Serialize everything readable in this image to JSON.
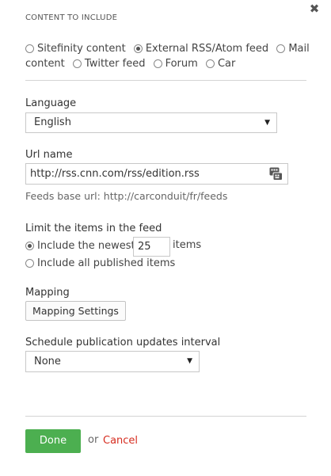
{
  "header": {
    "section_title": "CONTENT TO INCLUDE",
    "close_glyph": "✖",
    "close_icon": "close-icon"
  },
  "content_types": {
    "options": [
      {
        "label": "Sitefinity content",
        "checked": false
      },
      {
        "label": "External RSS/Atom feed",
        "checked": true
      },
      {
        "label": "Mail content",
        "checked": false
      },
      {
        "label": "Twitter feed",
        "checked": false
      },
      {
        "label": "Forum",
        "checked": false
      },
      {
        "label": "Car",
        "checked": false
      }
    ],
    "mail_line1": "Mail",
    "mail_line2": "content"
  },
  "language": {
    "label": "Language",
    "selected": "English",
    "arrow": "▼"
  },
  "url": {
    "label": "Url name",
    "value": "http://rss.cnn.com/rss/edition.rss",
    "hint": "Feeds base url: http://carconduit/fr/feeds",
    "icon": "feed-selector-icon"
  },
  "limit": {
    "label": "Limit the items in the feed",
    "newest_prefix": "Include the newest",
    "newest_value": "25",
    "newest_suffix": "items",
    "all_label": "Include all published items",
    "newest_checked": true
  },
  "mapping": {
    "label": "Mapping",
    "button_label": "Mapping Settings"
  },
  "schedule": {
    "label": "Schedule publication updates interval",
    "selected": "None",
    "arrow": "▼"
  },
  "footer": {
    "done_label": "Done",
    "or_label": "or",
    "cancel_label": "Cancel"
  },
  "colors": {
    "done_bg": "#4caf50",
    "cancel": "#d62d20",
    "divider": "#d4d4d4"
  }
}
